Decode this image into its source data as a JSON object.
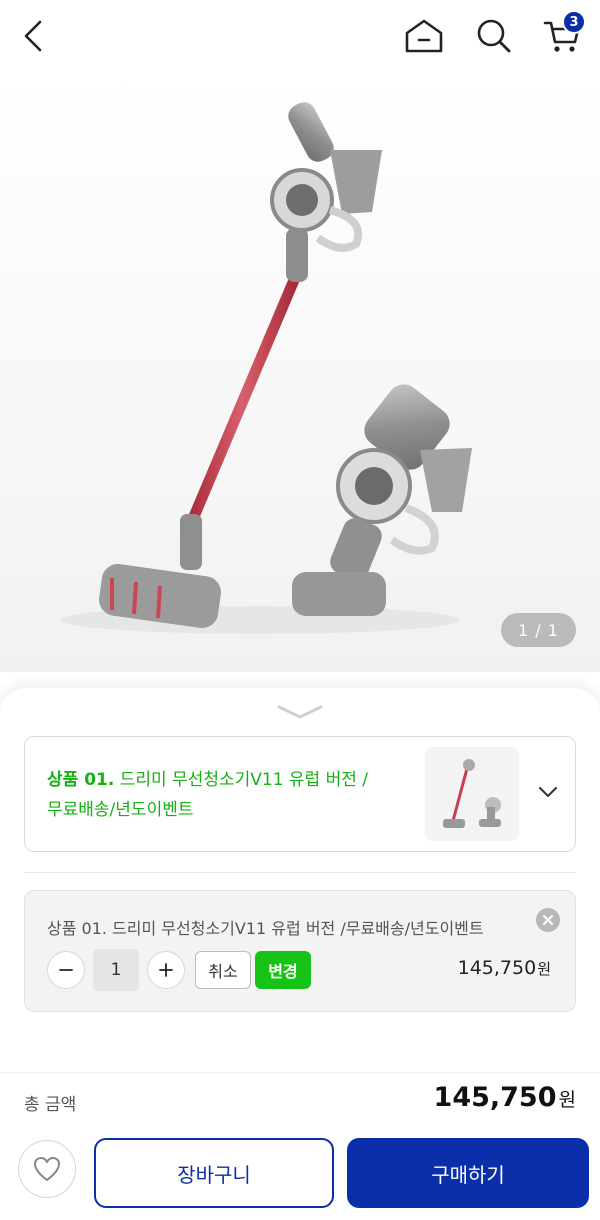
{
  "header": {
    "cart_count": "3"
  },
  "gallery": {
    "page_indicator": "1 / 1"
  },
  "option": {
    "prefix": "상품 01.",
    "name_line1": " 드리미 무선청소기V11 유럽 버전 /",
    "name_line2": "무료배송/년도이벤트"
  },
  "selected": {
    "name": "상품 01. 드리미 무선청소기V11 유럽 버전 /무료배송/년도이벤트",
    "quantity": "1",
    "cancel_label": "취소",
    "change_label": "변경",
    "price": "145,750",
    "currency": "원"
  },
  "total": {
    "label": "총 금액",
    "price": "145,750",
    "currency": "원"
  },
  "actions": {
    "cart_label": "장바구니",
    "buy_label": "구매하기"
  },
  "colors": {
    "brand_blue": "#0b2fa8",
    "option_green": "#15b215",
    "change_green": "#17c317",
    "vacuum_red": "#c8404e"
  }
}
